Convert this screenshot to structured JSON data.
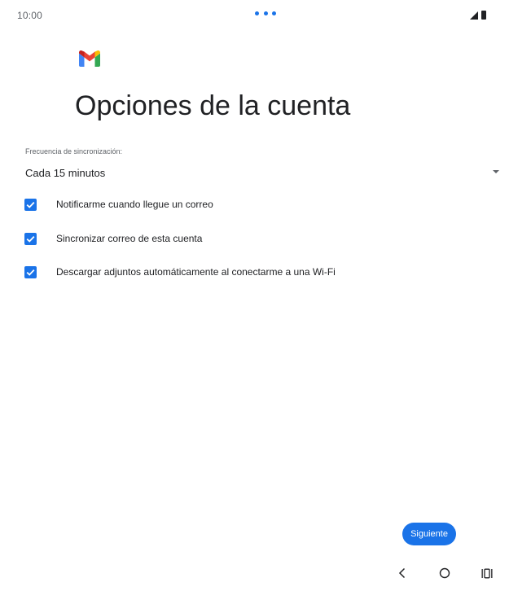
{
  "status_bar": {
    "time": "10:00"
  },
  "header": {
    "title": "Opciones de la cuenta",
    "logo_icon": "gmail-icon"
  },
  "sync": {
    "label": "Frecuencia de sincronización:",
    "value": "Cada 15 minutos"
  },
  "options": [
    {
      "label": "Notificarme cuando llegue un correo",
      "checked": true
    },
    {
      "label": "Sincronizar correo de esta cuenta",
      "checked": true
    },
    {
      "label": "Descargar adjuntos automáticamente al conectarme a una Wi-Fi",
      "checked": true
    }
  ],
  "actions": {
    "next_label": "Siguiente"
  },
  "colors": {
    "accent": "#1a73e8",
    "text": "#202124",
    "secondary_text": "#5f6368"
  },
  "nav_bar": {
    "back_icon": "back-chevron-icon",
    "home_icon": "home-circle-icon",
    "recents_icon": "recents-icon"
  }
}
